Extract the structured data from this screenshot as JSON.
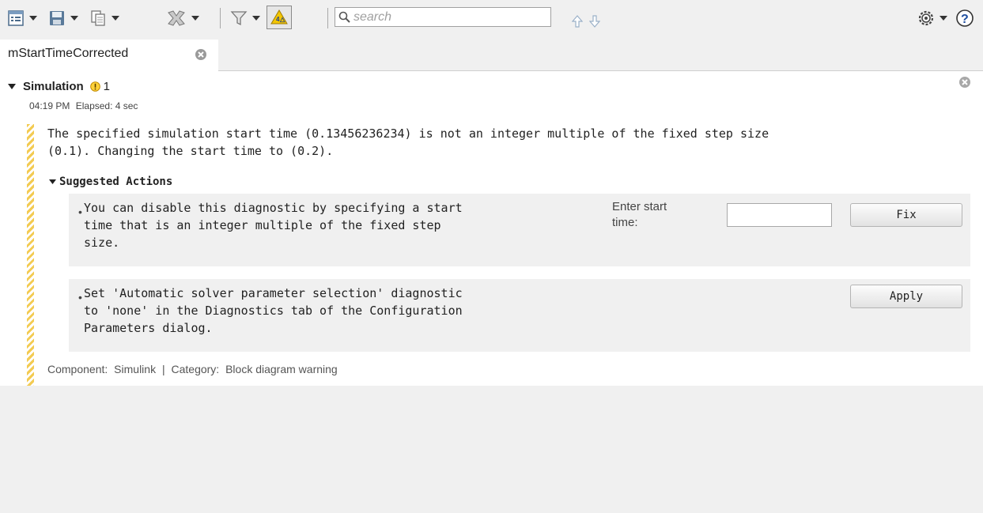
{
  "toolbar": {
    "icons": [
      "report-icon",
      "save-icon",
      "copy-icon",
      "clear-icon",
      "filter-icon",
      "warning-filter-icon",
      "settings-icon",
      "help-icon"
    ],
    "search": {
      "placeholder": "search",
      "value": ""
    },
    "nav": [
      "arrow-up-icon",
      "arrow-down-icon"
    ]
  },
  "tab": {
    "label": "mStartTimeCorrected"
  },
  "section": {
    "title": "Simulation",
    "warning_count": "1",
    "time": "04:19 PM",
    "elapsed": "Elapsed: 4 sec"
  },
  "message": {
    "line1": "The specified simulation start time (0.13456236234) is not an integer multiple of the fixed step size",
    "line2": "(0.1). Changing the start time to (0.2)."
  },
  "suggested": {
    "heading": "Suggested Actions",
    "actions": [
      {
        "lines": [
          "You can disable this diagnostic by specifying a start",
          "time that is an integer multiple of the fixed step",
          "size."
        ],
        "field_label_1": "Enter start",
        "field_label_2": "time:",
        "field_value": "",
        "button": "Fix"
      },
      {
        "lines": [
          "Set 'Automatic solver parameter selection' diagnostic",
          "to 'none' in the Diagnostics tab of the Configuration",
          "Parameters dialog."
        ],
        "button": "Apply"
      }
    ]
  },
  "footer": {
    "component_label": "Component:",
    "component": "Simulink",
    "separator": "|",
    "category_label": "Category:",
    "category": "Block diagram warning"
  },
  "colors": {
    "warning_stripe": "#f3cb52",
    "warning_icon": "#e8b800",
    "toolbar_bg": "#f0f0f0"
  }
}
